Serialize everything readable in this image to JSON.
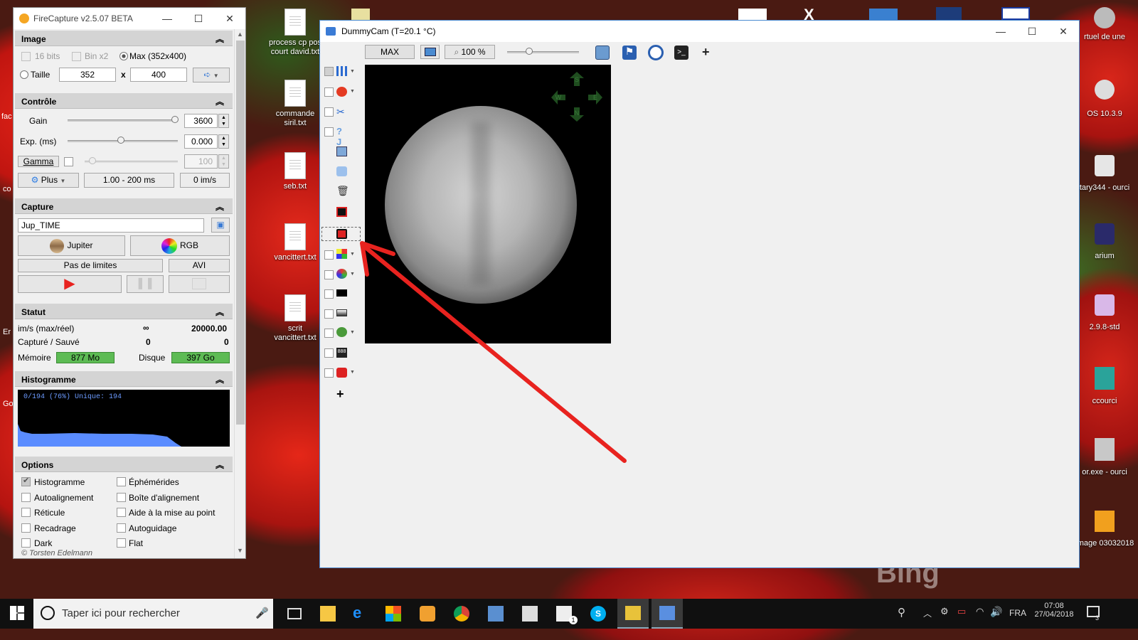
{
  "desktop_icons": [
    {
      "label": "process cp pos court david.txt"
    },
    {
      "label": "commande siril.txt"
    },
    {
      "label": "seb.txt"
    },
    {
      "label": "vancittert.txt"
    },
    {
      "label": "scrit vancittert.txt"
    },
    {
      "label": "rtuel de une"
    },
    {
      "label": "OS 10.3.9"
    },
    {
      "label": "tary344 - ourci"
    },
    {
      "label": "arium"
    },
    {
      "label": "2.9.8-std"
    },
    {
      "label": "ccourci"
    },
    {
      "label": "or.exe - ourci"
    },
    {
      "label": "Image 03032018"
    }
  ],
  "firecapture": {
    "title": "FireCapture v2.5.07 BETA",
    "image": {
      "header": "Image",
      "bits16": "16 bits",
      "binx2": "Bin x2",
      "max": "Max (352x400)",
      "taille": "Taille",
      "width": "352",
      "x": "x",
      "height": "400"
    },
    "controle": {
      "header": "Contrôle",
      "gain_label": "Gain",
      "gain_value": "3600",
      "exp_label": "Exp. (ms)",
      "exp_value": "0.000",
      "gamma_label": "Gamma",
      "gamma_value": "100",
      "plus_label": "Plus",
      "range": "1.00 - 200 ms",
      "rate": "0 im/s"
    },
    "capture": {
      "header": "Capture",
      "filename": "Jup_TIME",
      "object": "Jupiter",
      "filter": "RGB",
      "limit": "Pas de limites",
      "format": "AVI"
    },
    "statut": {
      "header": "Statut",
      "ims_label": "im/s (max/réel)",
      "ims_max": "∞",
      "ims_real": "20000.00",
      "cap_label": "Capturé / Sauvé",
      "cap_value": "0",
      "saved_value": "0",
      "mem_label": "Mémoire",
      "mem_value": "877 Mo",
      "disk_label": "Disque",
      "disk_value": "397 Go"
    },
    "histogramme": {
      "header": "Histogramme",
      "info": "0/194 (76%)  Unique: 194"
    },
    "options": {
      "header": "Options",
      "items": [
        {
          "label": "Histogramme",
          "checked": true
        },
        {
          "label": "Éphémérides",
          "checked": false
        },
        {
          "label": "Autoalignement",
          "checked": false
        },
        {
          "label": "Boîte d'alignement",
          "checked": false
        },
        {
          "label": "Réticule",
          "checked": false
        },
        {
          "label": "Aide à la mise au point",
          "checked": false
        },
        {
          "label": "Recadrage",
          "checked": false
        },
        {
          "label": "Autoguidage",
          "checked": false
        },
        {
          "label": "Dark",
          "checked": false
        },
        {
          "label": "Flat",
          "checked": false
        }
      ],
      "copyright": "© Torsten Edelmann"
    }
  },
  "dummycam": {
    "title": "DummyCam (T=20.1 °C)",
    "max_label": "MAX",
    "zoom": "100 %",
    "compass": {
      "n": "N",
      "s": "S",
      "e": "E",
      "w": "W"
    }
  },
  "taskbar": {
    "search_placeholder": "Taper ici pour rechercher",
    "language": "FRA",
    "time": "07:08",
    "date": "27/04/2018",
    "notifications": "3",
    "mail_badge": "1"
  },
  "watermark": "Bing",
  "colors": {
    "accent_red": "#e8231f",
    "green_status": "#5dbb54",
    "hist_blue": "#5a8cff"
  }
}
